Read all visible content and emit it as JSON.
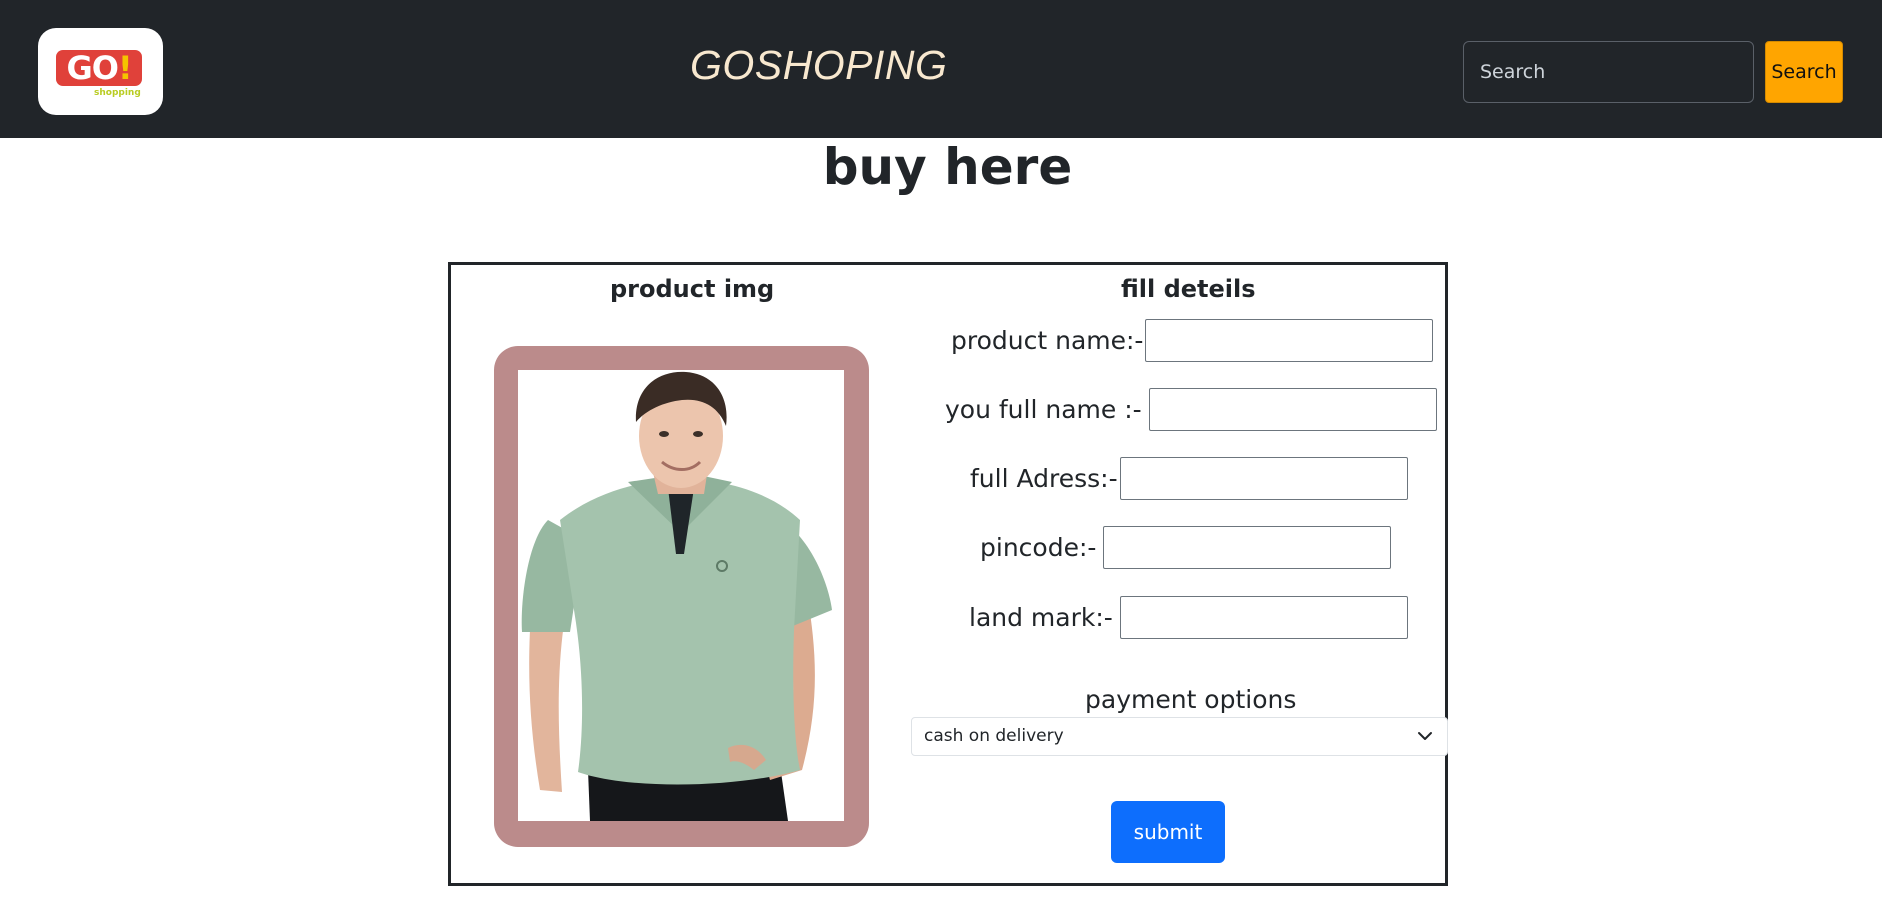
{
  "navbar": {
    "logo": {
      "main": "GO",
      "mark": "!",
      "sub": "shopping"
    },
    "brand": "GOSHOPING",
    "search": {
      "placeholder": "Search",
      "button_label": "Search"
    },
    "colors": {
      "background": "#212529",
      "search_button": "#ffa500",
      "brand_text": "#f8e8cf"
    }
  },
  "page": {
    "title": "buy here"
  },
  "card": {
    "image_heading": "product img",
    "form_heading": "fill deteils",
    "image_frame_color": "#bb8b8b",
    "fields": [
      {
        "label": "product name:-",
        "value": ""
      },
      {
        "label": "you full name :-",
        "value": ""
      },
      {
        "label": "full Adress:-",
        "value": ""
      },
      {
        "label": "pincode:-",
        "value": ""
      },
      {
        "label": "land mark:-",
        "value": ""
      }
    ],
    "payment": {
      "label": "payment options",
      "selected": "cash on delivery"
    },
    "submit_label": "submit",
    "submit_color": "#0d6efd"
  }
}
